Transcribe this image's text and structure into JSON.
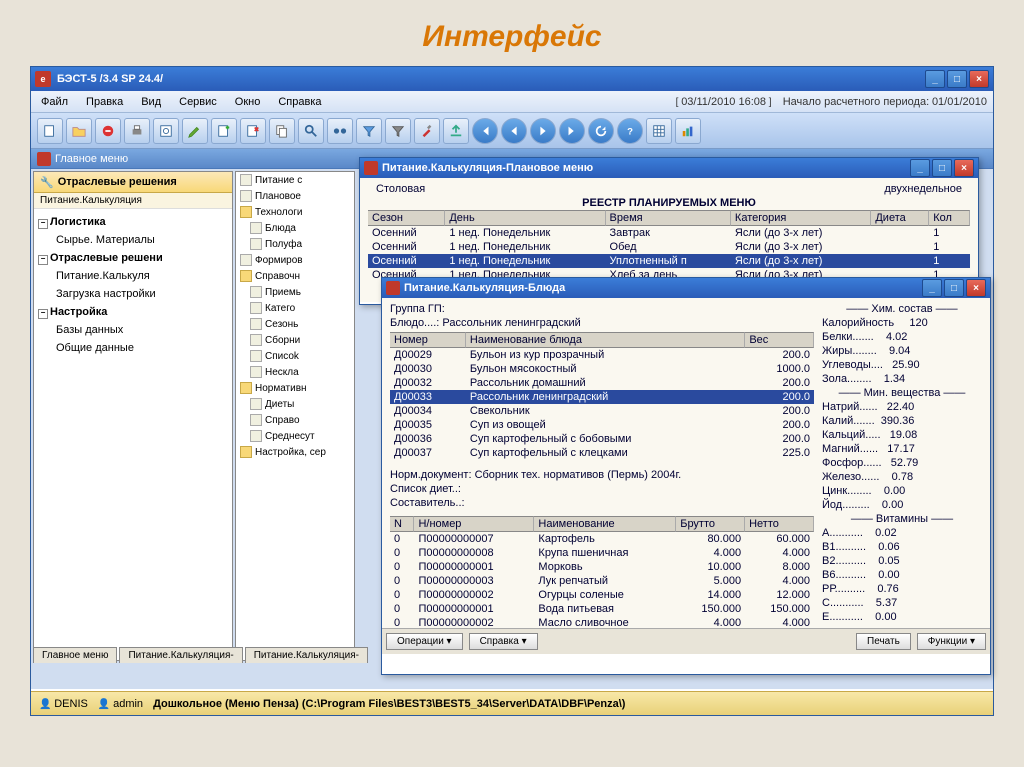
{
  "slide_title": "Интерфейс",
  "app": {
    "title": "БЭСТ-5 /3.4 SP 24.4/",
    "datetime": "03/11/2010 16:08",
    "period_label": "Начало расчетного периода:",
    "period": "01/01/2010"
  },
  "menu": [
    "Файл",
    "Правка",
    "Вид",
    "Сервис",
    "Окно",
    "Справка"
  ],
  "mdi": {
    "title": "Главное меню"
  },
  "nav": {
    "header": "Отраслевые решения",
    "sub": "Питание.Калькуляция",
    "tree": [
      {
        "t": "Логистика",
        "cls": "node exp bold"
      },
      {
        "t": "Сырье. Материалы",
        "cls": "leaf"
      },
      {
        "t": "Отраслевые решени",
        "cls": "node exp bold"
      },
      {
        "t": "Питание.Калькуля",
        "cls": "leaf"
      },
      {
        "t": "Загрузка настройки",
        "cls": "leaf"
      },
      {
        "t": "Настройка",
        "cls": "node exp bold"
      },
      {
        "t": "Базы данных",
        "cls": "leaf"
      },
      {
        "t": "Общие данные",
        "cls": "leaf"
      }
    ]
  },
  "midlist": [
    {
      "t": "Питание с",
      "cls": "item"
    },
    {
      "t": "Плановое",
      "cls": "item"
    },
    {
      "t": "Технологи",
      "cls": "item folder"
    },
    {
      "t": "Блюда",
      "cls": "item exp"
    },
    {
      "t": "Полуфа",
      "cls": "item exp"
    },
    {
      "t": "Формиров",
      "cls": "item"
    },
    {
      "t": "Справочн",
      "cls": "item folder"
    },
    {
      "t": "Приемь",
      "cls": "item exp"
    },
    {
      "t": "Катего",
      "cls": "item exp"
    },
    {
      "t": "Сезонь",
      "cls": "item exp"
    },
    {
      "t": "Сборни",
      "cls": "item exp"
    },
    {
      "t": "Списоk",
      "cls": "item exp"
    },
    {
      "t": "Нескла",
      "cls": "item exp"
    },
    {
      "t": "Нормативн",
      "cls": "item folder"
    },
    {
      "t": "Диеты",
      "cls": "item exp"
    },
    {
      "t": "Справо",
      "cls": "item exp"
    },
    {
      "t": "Среднесут",
      "cls": "item exp"
    },
    {
      "t": "Настройка, сер",
      "cls": "item folder"
    }
  ],
  "plan": {
    "title": "Питание.Калькуляция-Плановое меню",
    "left_label": "Столовая",
    "right_label": "двухнедельное",
    "heading": "РЕЕСТР ПЛАНИРУЕМЫХ МЕНЮ",
    "cols": [
      "Сезон",
      "День",
      "Время",
      "Категория",
      "Диета",
      "Кол"
    ],
    "rows": [
      [
        "Осенний",
        "1 нед. Понедельник",
        "Завтрак",
        "Ясли (до 3-х лет)",
        "",
        "1"
      ],
      [
        "Осенний",
        "1 нед. Понедельник",
        "Обед",
        "Ясли (до 3-х лет)",
        "",
        "1"
      ],
      [
        "Осенний",
        "1 нед. Понедельник",
        "Уплотненный п",
        "Ясли (до 3-х лет)",
        "",
        "1"
      ],
      [
        "Осенний",
        "1 нед. Понедельник",
        "Хлеб за день",
        "Ясли (до 3-х лет)",
        "",
        "1"
      ]
    ],
    "selected": 2
  },
  "dish": {
    "title": "Питание.Калькуляция-Блюда",
    "group_label": "Группа ГП:",
    "name_label": "Блюдо....:",
    "name_value": "Рассольник ленинградский",
    "cols": [
      "Номер",
      "Наименование блюда",
      "Вес"
    ],
    "rows": [
      [
        "Д00029",
        "Бульон из кур прозрачный",
        "200.0"
      ],
      [
        "Д00030",
        "Бульон мясокостный",
        "1000.0"
      ],
      [
        "Д00032",
        "Рассольник домашний",
        "200.0"
      ],
      [
        "Д00033",
        "Рассольник ленинградский",
        "200.0"
      ],
      [
        "Д00034",
        "Свекольник",
        "200.0"
      ],
      [
        "Д00035",
        "Суп из овощей",
        "200.0"
      ],
      [
        "Д00036",
        "Суп картофельный с бобовыми",
        "200.0"
      ],
      [
        "Д00037",
        "Суп картофельный с клецками",
        "225.0"
      ]
    ],
    "selected": 3,
    "norm_label": "Норм.документ:",
    "norm_value": "Сборник тех. нормативов (Пермь) 2004г.",
    "diet_label": "Список диет..:",
    "author_label": "Составитель..:",
    "ing_cols": [
      "N",
      "Н/номер",
      "Наименование",
      "Брутто",
      "Нетто"
    ],
    "ings": [
      [
        "0",
        "П00000000007",
        "Картофель",
        "80.000",
        "60.000"
      ],
      [
        "0",
        "П00000000008",
        "Крупа пшеничная",
        "4.000",
        "4.000"
      ],
      [
        "0",
        "П00000000001",
        "Морковь",
        "10.000",
        "8.000"
      ],
      [
        "0",
        "П00000000003",
        "Лук репчатый",
        "5.000",
        "4.000"
      ],
      [
        "0",
        "П00000000002",
        "Огурцы соленые",
        "14.000",
        "12.000"
      ],
      [
        "0",
        "П00000000001",
        "Вода питьевая",
        "150.000",
        "150.000"
      ],
      [
        "0",
        "П00000000002",
        "Масло сливочное",
        "4.000",
        "4.000"
      ]
    ],
    "buttons": [
      "Операции ▾",
      "Справка ▾",
      "Печать",
      "Функции ▾"
    ]
  },
  "chem": {
    "header1": "—— Хим. состав ——",
    "rows1": [
      [
        "Калорийность",
        "120"
      ],
      [
        "Белки.......",
        "4.02"
      ],
      [
        "Жиры........",
        "9.04"
      ],
      [
        "Углеводы....",
        "25.90"
      ],
      [
        "Зола........",
        "1.34"
      ]
    ],
    "header2": "—— Мин. вещества ——",
    "rows2": [
      [
        "Натрий......",
        "22.40"
      ],
      [
        "Калий.......",
        "390.36"
      ],
      [
        "Кальций.....",
        "19.08"
      ],
      [
        "Магний......",
        "17.17"
      ],
      [
        "Фосфор......",
        "52.79"
      ],
      [
        "Железо......",
        "0.78"
      ],
      [
        "Цинк........",
        "0.00"
      ],
      [
        "Йод.........",
        "0.00"
      ]
    ],
    "header3": "—— Витамины ——",
    "rows3": [
      [
        "А...........",
        "0.02"
      ],
      [
        "В1..........",
        "0.06"
      ],
      [
        "В2..........",
        "0.05"
      ],
      [
        "В6..........",
        "0.00"
      ],
      [
        "РР..........",
        "0.76"
      ],
      [
        "С...........",
        "5.37"
      ],
      [
        "Е...........",
        "0.00"
      ]
    ]
  },
  "tabs": [
    "Главное меню",
    "Питание.Калькуляция-",
    "Питание.Калькуляция-"
  ],
  "status": {
    "host": "DENIS",
    "user": "admin",
    "db": "Дошкольное (Меню Пенза) (C:\\Program Files\\BEST3\\BEST5_34\\Server\\DATA\\DBF\\Penza\\)"
  }
}
